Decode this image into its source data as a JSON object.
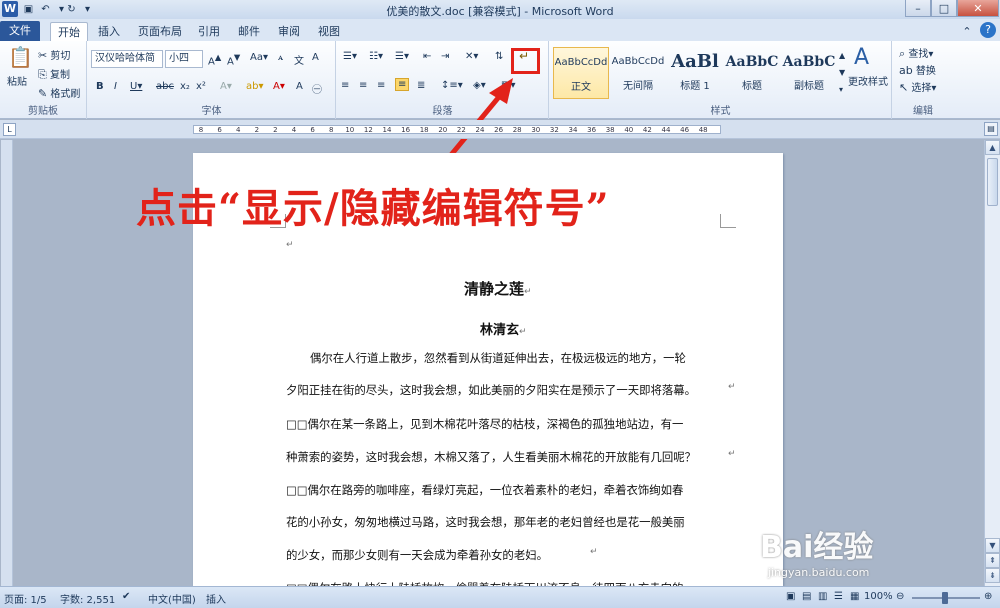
{
  "app": {
    "window_title": "优美的散文.doc [兼容模式] - Microsoft Word",
    "logo_letter": "W"
  },
  "tabs": [
    "文件",
    "开始",
    "插入",
    "页面布局",
    "引用",
    "邮件",
    "审阅",
    "视图"
  ],
  "active_tab": "开始",
  "ribbon": {
    "clipboard": {
      "label": "剪贴板",
      "paste": "粘贴",
      "cut": "剪切",
      "copy": "复制",
      "format_painter": "格式刷"
    },
    "font": {
      "label": "字体",
      "font_name": "汉仪哈哈体简",
      "font_size": "小四"
    },
    "paragraph": {
      "label": "段落",
      "show_hide_tooltip": "显示/隐藏编辑符号"
    },
    "styles": {
      "label": "样式",
      "items": [
        {
          "preview": "AaBbCcDd",
          "name": "正文",
          "selected": true
        },
        {
          "preview": "AaBbCcDd",
          "name": "无间隔",
          "selected": false
        },
        {
          "preview": "AaBl",
          "name": "标题 1",
          "selected": false
        },
        {
          "preview": "AaBbC",
          "name": "标题",
          "selected": false
        },
        {
          "preview": "AaBbC",
          "name": "副标题",
          "selected": false
        }
      ],
      "change_styles": "更改样式"
    },
    "editing": {
      "label": "编辑",
      "find": "查找",
      "replace": "替换",
      "select": "选择"
    }
  },
  "ruler_ticks": [
    "8",
    "6",
    "4",
    "2",
    "2",
    "4",
    "6",
    "8",
    "10",
    "12",
    "14",
    "16",
    "18",
    "20",
    "22",
    "24",
    "26",
    "28",
    "30",
    "32",
    "34",
    "36",
    "38",
    "40",
    "42",
    "44",
    "46",
    "48"
  ],
  "annotation": "点击“显示/隐藏编辑符号”",
  "document": {
    "title": "清静之莲",
    "author": "林清玄",
    "lines": [
      "偶尔在人行道上散步，忽然看到从街道延伸出去，在极远极远的地方，一轮",
      "夕阳正挂在街的尽头，这时我会想，如此美丽的夕阳实在是预示了一天即将落幕。",
      "□□偶尔在某一条路上，见到木棉花叶落尽的枯枝，深褐色的孤独地站边，有一",
      "种萧索的姿势，这时我会想，木棉又落了，人生看美丽木棉花的开放能有几回呢？",
      "□□偶尔在路旁的咖啡座，看绿灯亮起，一位衣着素朴的老妇，牵着衣饰绚如春",
      "花的小孙女，匆匆地横过马路，这时我会想，那年老的老妇曾经也是花一般美丽",
      "的少女，而那少女则有一天会成为牵着孙女的老妇。",
      "□□偶尔在路上快行上陆桥故炊，偷婴着在陆桥下川流不息，待四面八方赤向的"
    ],
    "paragraph_mark": "↵"
  },
  "status_bar": {
    "page": "页面: 1/5",
    "words": "字数: 2,551",
    "language": "中文(中国)",
    "mode": "插入",
    "zoom": "100%"
  },
  "watermark": {
    "brand": "Bai经验",
    "url": "jingyan.baidu.com"
  },
  "colors": {
    "annotation_red": "#e2231a",
    "file_tab": "#2b579a"
  }
}
